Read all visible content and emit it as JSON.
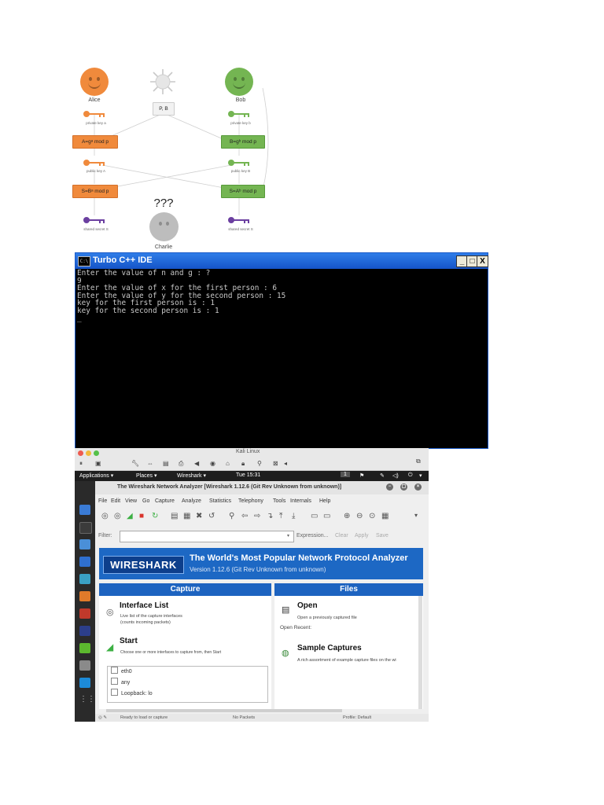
{
  "diagram": {
    "alice": "Alice",
    "bob": "Bob",
    "charlie": "Charlie",
    "public_params": "P, B",
    "unknown": "???",
    "alice_private": "private key a",
    "bob_private": "private key b",
    "alice_compute": "A=gᵃ mod p",
    "bob_compute": "B=gᵇ mod p",
    "alice_public": "public key A",
    "bob_public": "public key B",
    "alice_shared_calc": "S=Bᵃ mod p",
    "bob_shared_calc": "S=Aᵇ mod p",
    "alice_secret": "shared secret S",
    "bob_secret": "shared secret S",
    "colors": {
      "alice": "#f08a3c",
      "bob": "#74b552",
      "charlie": "#bdbdbd",
      "shared_key": "#6b3fa0"
    }
  },
  "turbo": {
    "icon": "C:\\",
    "title": "Turbo C++ IDE",
    "controls": {
      "minimize": "_",
      "maximize": "□",
      "close": "X"
    },
    "console": [
      "Enter the value of n and g : ?",
      "9",
      "Enter the value of x for the first person : 6",
      "Enter the value of y for the second person : 15",
      "key for the first person is : 1",
      "key for the second person is : 1",
      "_"
    ]
  },
  "kali": {
    "vm_title": "Kali Linux",
    "topbar": {
      "applications": "Applications ▾",
      "places": "Places ▾",
      "app": "Wireshark ▾",
      "clock": "Tue 15:31",
      "workspace": "1"
    },
    "wireshark": {
      "title": "The Wireshark Network Analyzer  [Wireshark 1.12.6  (Git Rev Unknown from unknown)]",
      "menu": [
        "File",
        "Edit",
        "View",
        "Go",
        "Capture",
        "Analyze",
        "Statistics",
        "Telephony",
        "Tools",
        "Internals",
        "Help"
      ],
      "filter_label": "Filter:",
      "filter_value": "",
      "filter_actions": {
        "expression": "Expression...",
        "clear": "Clear",
        "apply": "Apply",
        "save": "Save"
      },
      "logo": "WIRESHARK",
      "banner_title": "The World's Most Popular Network Protocol Analyzer",
      "banner_version": "Version 1.12.6 (Git Rev Unknown from unknown)",
      "capture": {
        "header": "Capture",
        "interface_list": "Interface List",
        "interface_desc_1": "Live list of the capture interfaces",
        "interface_desc_2": "(counts incoming packets)",
        "start": "Start",
        "start_desc": "Choose one or more interfaces to capture from, then Start",
        "interfaces": [
          "eth0",
          "any",
          "Loopback: lo"
        ]
      },
      "files": {
        "header": "Files",
        "open": "Open",
        "open_desc": "Open a previously captured file",
        "open_recent": "Open Recent:",
        "sample": "Sample Captures",
        "sample_desc": "A rich assortment of example capture files on the wi"
      },
      "status": {
        "ready": "Ready to load or capture",
        "packets": "No Packets",
        "profile": "Profile: Default"
      }
    }
  }
}
